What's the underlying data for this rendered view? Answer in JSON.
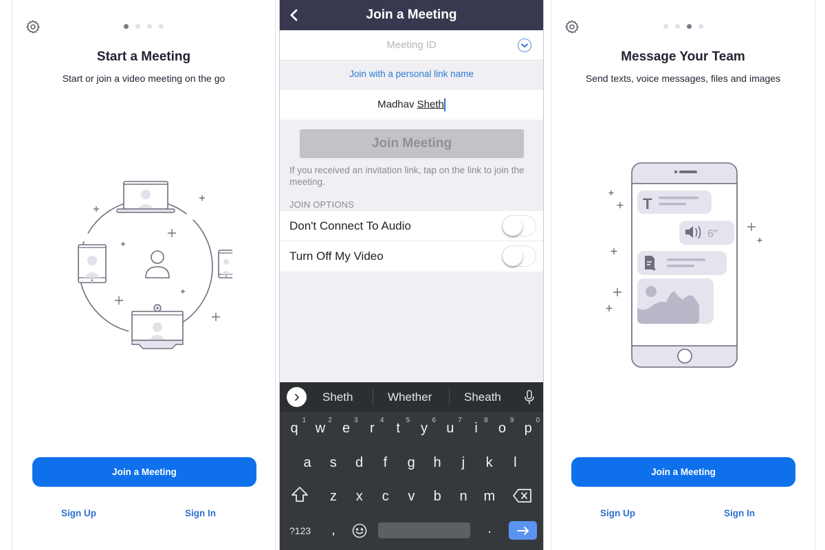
{
  "left_panel": {
    "settings_icon": "gear-icon",
    "page_dots": {
      "total": 4,
      "active_index": 0
    },
    "title": "Start a Meeting",
    "subtitle": "Start or join a video meeting on the go",
    "illustration": "devices-circle-illustration",
    "primary_button": "Join a Meeting",
    "sign_up": "Sign Up",
    "sign_in": "Sign In"
  },
  "middle_panel": {
    "header": {
      "title": "Join a Meeting",
      "back_icon": "chevron-left-icon"
    },
    "meeting_id": {
      "placeholder": "Meeting ID",
      "value": ""
    },
    "personal_link": "Join with a personal link name",
    "name_field": {
      "first": "Madhav",
      "second": "Sheth"
    },
    "join_button": "Join Meeting",
    "hint": "If you received an invitation link, tap on the link to join the meeting.",
    "section_label": "JOIN OPTIONS",
    "options": [
      {
        "label": "Don't Connect To Audio",
        "on": false
      },
      {
        "label": "Turn Off My Video",
        "on": false
      }
    ],
    "keyboard": {
      "suggestions": [
        "Sheth",
        "Whether",
        "Sheath"
      ],
      "row1": [
        "q",
        "w",
        "e",
        "r",
        "t",
        "y",
        "u",
        "i",
        "o",
        "p"
      ],
      "row1_hints": [
        "1",
        "2",
        "3",
        "4",
        "5",
        "6",
        "7",
        "8",
        "9",
        "0"
      ],
      "row2": [
        "a",
        "s",
        "d",
        "f",
        "g",
        "h",
        "j",
        "k",
        "l"
      ],
      "row3": [
        "z",
        "x",
        "c",
        "v",
        "b",
        "n",
        "m"
      ],
      "symbols_key": "?123",
      "comma": ",",
      "period": "."
    }
  },
  "right_panel": {
    "settings_icon": "gear-icon",
    "page_dots": {
      "total": 4,
      "active_index": 2
    },
    "title": "Message Your Team",
    "subtitle": "Send texts, voice messages, files and images",
    "illustration": "phone-chat-illustration",
    "voice_duration": "6″",
    "primary_button": "Join a Meeting",
    "sign_up": "Sign Up",
    "sign_in": "Sign In"
  },
  "colors": {
    "primary_blue": "#0e71eb",
    "link_blue": "#2f6fcf",
    "header_dark": "#383850",
    "keyboard_bg": "#36393c",
    "enter_key": "#5b93f0",
    "illustration_stroke": "#6e6e7e",
    "illustration_fill": "#e4e4ee"
  }
}
